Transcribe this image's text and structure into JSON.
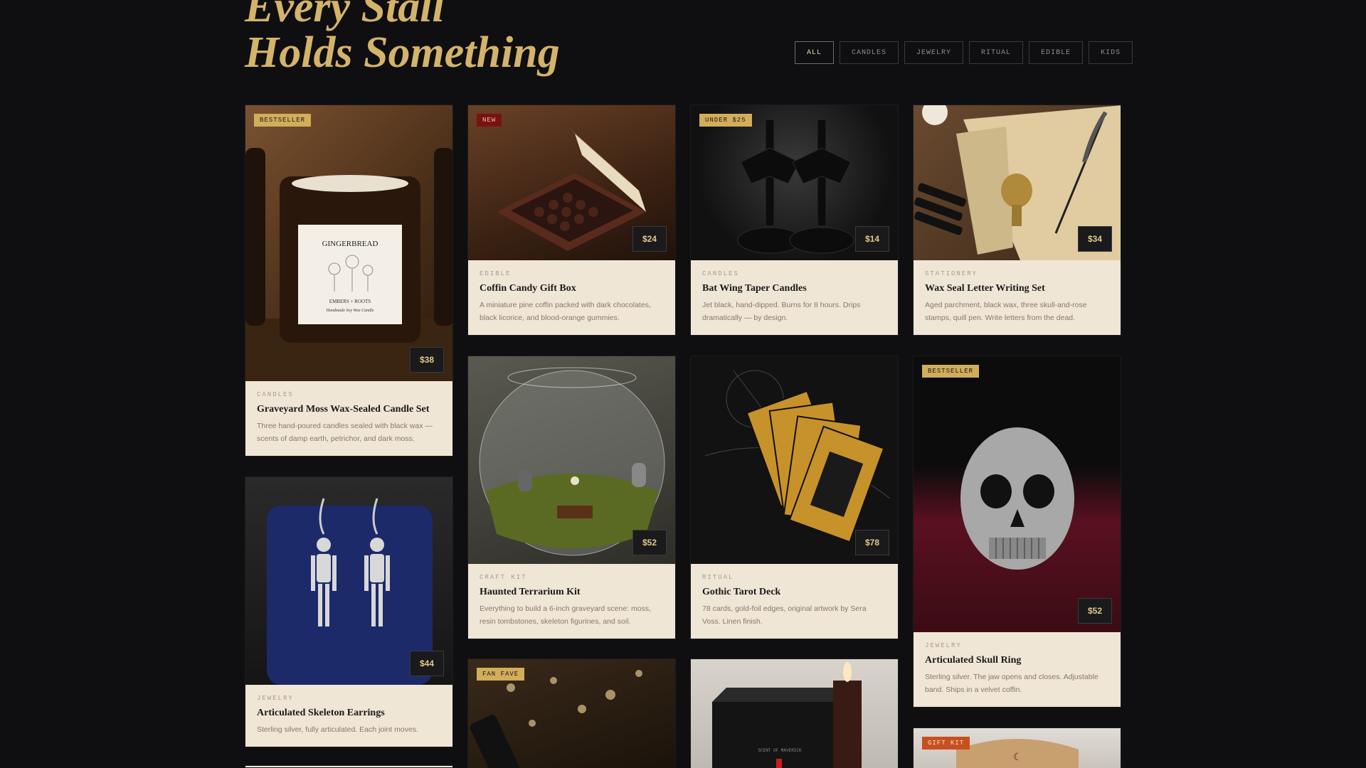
{
  "hero": {
    "line1": "Every Stall",
    "line2": "Holds Something"
  },
  "filters": [
    {
      "label": "ALL"
    },
    {
      "label": "CANDLES"
    },
    {
      "label": "JEWELRY"
    },
    {
      "label": "RITUAL"
    },
    {
      "label": "EDIBLE"
    },
    {
      "label": "KIDS"
    }
  ],
  "products": [
    {
      "badge": "BESTSELLER",
      "price": "$38",
      "category": "CANDLES",
      "name": "Graveyard Moss Wax-Sealed Candle Set",
      "description": "Three hand-poured candles sealed with black wax — scents of damp earth, petrichor, and dark moss.",
      "label_text": "GINGERBREAD",
      "label_sub": "EMBERS + ROOTS",
      "label_sub2": "Handmade Soy Wax Candle"
    },
    {
      "badge": "NEW",
      "price": "$24",
      "category": "EDIBLE",
      "name": "Coffin Candy Gift Box",
      "description": "A miniature pine coffin packed with dark chocolates, black licorice, and blood-orange gummies."
    },
    {
      "badge": "UNDER $25",
      "price": "$14",
      "category": "CANDLES",
      "name": "Bat Wing Taper Candles",
      "description": "Jet black, hand-dipped. Burns for 8 hours. Drips dramatically — by design."
    },
    {
      "badge": "",
      "price": "$34",
      "category": "STATIONERY",
      "name": "Wax Seal Letter Writing Set",
      "description": "Aged parchment, black wax, three skull-and-rose stamps, quill pen. Write letters from the dead."
    },
    {
      "badge": "",
      "price": "$52",
      "category": "CRAFT KIT",
      "name": "Haunted Terrarium Kit",
      "description": "Everything to build a 6-inch graveyard scene: moss, resin tombstones, skeleton figurines, and soil."
    },
    {
      "badge": "",
      "price": "$78",
      "category": "RITUAL",
      "name": "Gothic Tarot Deck",
      "description": "78 cards, gold-foil edges, original artwork by Sera Voss. Linen finish."
    },
    {
      "badge": "BESTSELLER",
      "price": "$52",
      "category": "JEWELRY",
      "name": "Articulated Skull Ring",
      "description": "Sterling silver. The jaw opens and closes. Adjustable band. Ships in a velvet coffin."
    },
    {
      "badge": "",
      "price": "$44",
      "category": "JEWELRY",
      "name": "Articulated Skeleton Earrings",
      "description": "Sterling silver, fully articulated. Each joint moves."
    },
    {
      "badge": "FAN FAVE"
    },
    {
      "badge": "",
      "box_text": "SCENT OF MAVERICK"
    },
    {
      "badge": "GIFT KIT"
    }
  ]
}
